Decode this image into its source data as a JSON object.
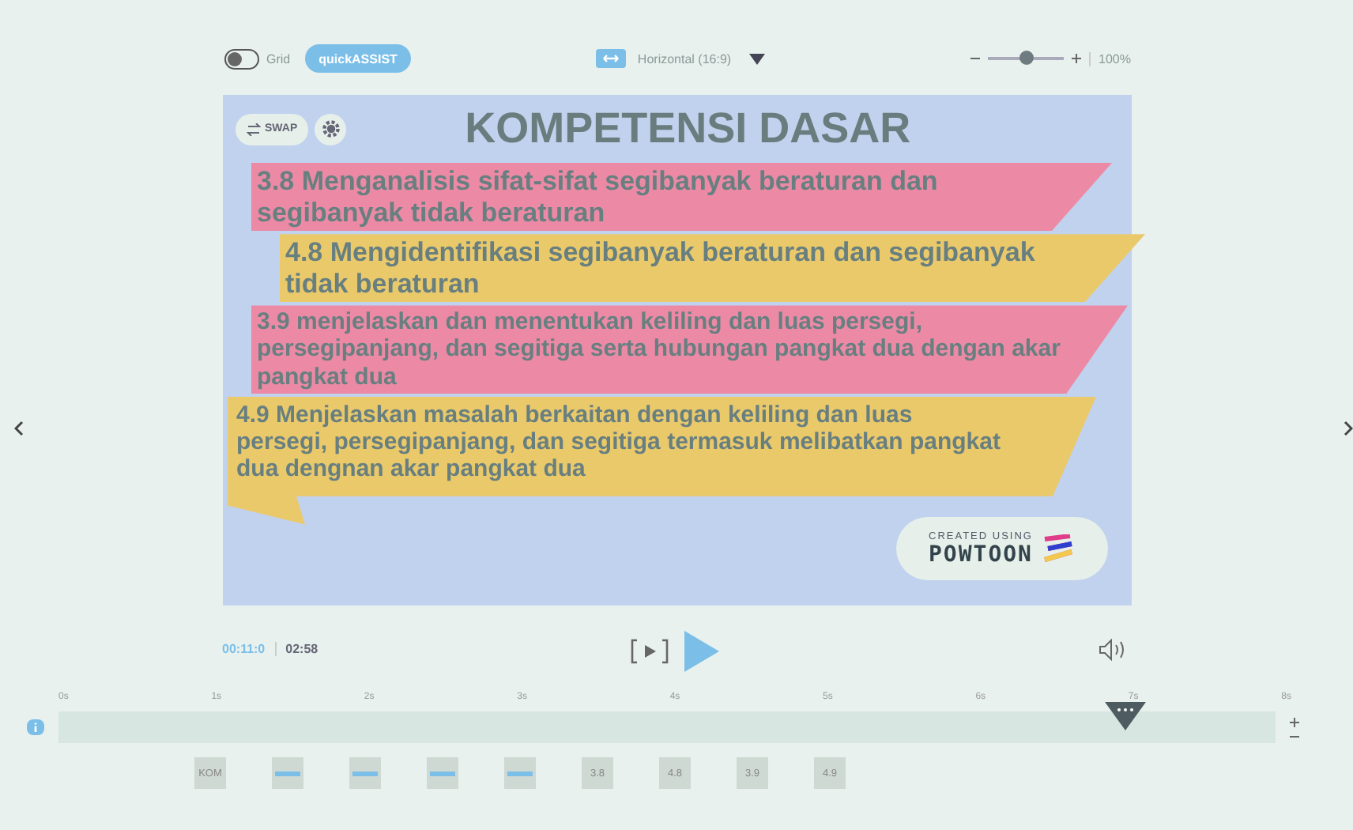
{
  "toolbar": {
    "grid": {
      "label": "Grid",
      "on": false
    },
    "assist_button": "quickASSIST",
    "orientation": "Horizontal (16:9)",
    "zoom": {
      "level": 0.5,
      "reading": "100%"
    }
  },
  "slide": {
    "swap_button": "SWAP",
    "title": "KOMPETENSI DASAR",
    "items": [
      {
        "text": "3.8 Menganalisis sifat-sifat segibanyak beraturan dan segibanyak tidak beraturan",
        "color": "#ec8aa6"
      },
      {
        "text": "4.8 Mengidentifikasi segibanyak beraturan dan segibanyak tidak beraturan",
        "color": "#eac96b"
      },
      {
        "text": "3.9 menjelaskan dan menentukan keliling dan luas persegi, persegipanjang, dan segitiga serta hubungan pangkat dua dengan akar pangkat dua",
        "color": "#ec8aa6"
      },
      {
        "text": "4.9 Menjelaskan masalah berkaitan dengan keliling dan luas persegi, persegipanjang, dan segitiga termasuk melibatkan pangkat dua dengnan akar pangkat dua",
        "color": "#eac96b"
      }
    ],
    "badge": {
      "caption": "CREATED USING",
      "brand": "POWTOON"
    }
  },
  "player": {
    "current_time": "00:11:0",
    "total_time": "02:58"
  },
  "timeline": {
    "ticks": [
      "0s",
      "1s",
      "2s",
      "3s",
      "4s",
      "5s",
      "6s",
      "7s",
      "8s"
    ],
    "playhead": {
      "level": 0.876
    },
    "thumbnails": [
      {
        "kind": "text",
        "label": "KOM"
      },
      {
        "kind": "bar"
      },
      {
        "kind": "bar"
      },
      {
        "kind": "bar"
      },
      {
        "kind": "bar"
      },
      {
        "kind": "text",
        "label": "3.8"
      },
      {
        "kind": "text",
        "label": "4.8"
      },
      {
        "kind": "text",
        "label": "3.9"
      },
      {
        "kind": "text",
        "label": "4.9"
      }
    ]
  }
}
